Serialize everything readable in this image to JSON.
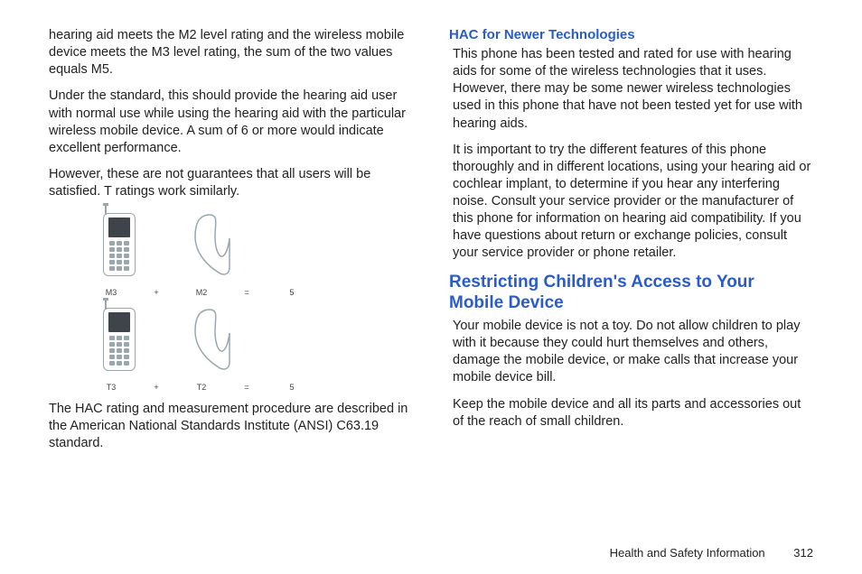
{
  "left": {
    "p1": "hearing aid meets the M2 level rating and the wireless mobile device meets the M3 level rating, the sum of the two values equals M5.",
    "p2": "Under the standard, this should provide the hearing aid user with normal use while using the hearing aid with the particular wireless mobile device. A sum of 6 or more would indicate excellent performance.",
    "p3": "However, these are not guarantees that all users will be satisfied. T ratings work similarly.",
    "diag": {
      "row1": {
        "a": "M3",
        "op": "+",
        "b": "M2",
        "eq": "=",
        "r": "5"
      },
      "row2": {
        "a": "T3",
        "op": "+",
        "b": "T2",
        "eq": "=",
        "r": "5"
      }
    },
    "p4": "The HAC rating and measurement procedure are described in the American National Standards Institute (ANSI) C63.19 standard."
  },
  "right": {
    "sub1": "HAC for Newer Technologies",
    "p1": "This phone has been tested and rated for use with hearing aids for some of the wireless technologies that it uses. However, there may be some newer wireless technologies used in this phone that have not been tested yet for use with hearing aids.",
    "p2": "It is important to try the different features of this phone thoroughly and in different locations, using your hearing aid or cochlear implant, to determine if you hear any interfering noise. Consult your service provider or the manufacturer of this phone for information on hearing aid compatibility. If you have questions about return or exchange policies, consult your service provider or phone retailer.",
    "section": "Restricting Children's Access to Your Mobile Device",
    "p3": "Your mobile device is not a toy. Do not allow children to play with it because they could hurt themselves and others, damage the mobile device, or make calls that increase your mobile device bill.",
    "p4": "Keep the mobile device and all its parts and accessories out of the reach of small children."
  },
  "footer": {
    "label": "Health and Safety Information",
    "page": "312"
  }
}
